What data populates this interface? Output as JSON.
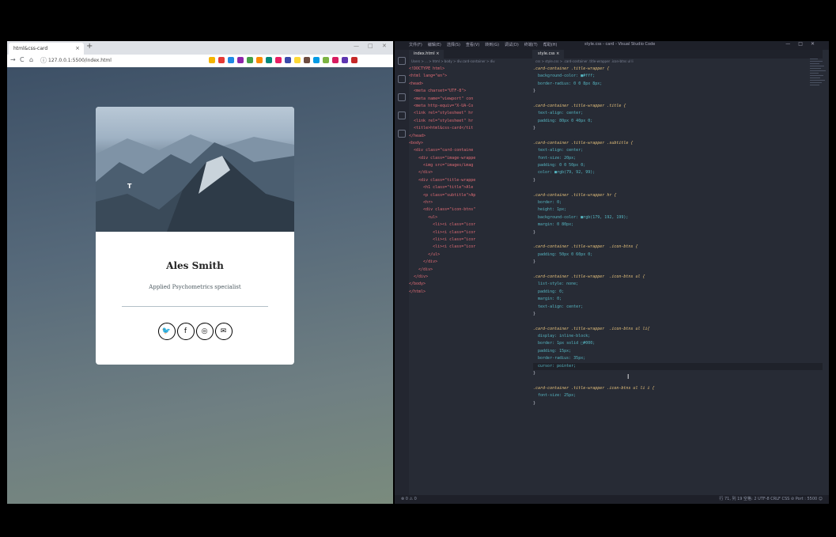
{
  "browser": {
    "tab_title": "html&css-card",
    "tab_close": "×",
    "new_tab": "+",
    "win_min": "—",
    "win_max": "□",
    "win_close": "✕",
    "back": "→",
    "reload": "C",
    "home": "⌂",
    "info": "ⓘ",
    "url": "127.0.0.1:5500/index.html",
    "ext_colors": [
      "#f4b400",
      "#e53935",
      "#1e88e5",
      "#8e24aa",
      "#43a047",
      "#fb8c00",
      "#00897b",
      "#e91e63",
      "#3949ab",
      "#fdd835",
      "#6d4c41",
      "#039be5",
      "#7cb342",
      "#d81b60",
      "#5e35b1",
      "#c62828"
    ]
  },
  "card": {
    "name": "Ales Smith",
    "subtitle": "Applied Psychometrics specialist",
    "icons": [
      {
        "icon": "twitter-icon",
        "glyph": "🐦"
      },
      {
        "icon": "facebook-icon",
        "glyph": "f"
      },
      {
        "icon": "instagram-icon",
        "glyph": "◎"
      },
      {
        "icon": "mail-icon",
        "glyph": "✉"
      }
    ]
  },
  "vscode": {
    "menu": [
      "文件(F)",
      "编辑(E)",
      "选择(S)",
      "查看(V)",
      "转到(G)",
      "调试(D)",
      "终端(T)",
      "帮助(H)"
    ],
    "window_title": "style.css - card - Visual Studio Code",
    "left_tab": "index.html",
    "left_tab_close": "×",
    "left_crumbs": "Users > ... > html > body > div.card-container > div",
    "right_tab": "style.css",
    "right_tab_close": "×",
    "right_crumbs": "css > style.css > .card-container .title-wrapper .icon-btns ul li",
    "status_left": "⊗ 0 ⚠ 0",
    "status_right": "行 71, 列 19   空格: 2   UTF-8   CRLF   CSS   ⊘ Port : 5500   ☺"
  },
  "html_code": [
    "<!DOCTYPE html>",
    "<html lang=\"en\">",
    "<head>",
    "  <meta charset=\"UTF-8\">",
    "  <meta name=\"viewport\" con",
    "  <meta http-equiv=\"X-UA-Co",
    "  <link rel=\"stylesheet\" hr",
    "  <link rel=\"stylesheet\" hr",
    "  <title>html&css-card</tit",
    "</head>",
    "<body>",
    "  <div class=\"card-containe",
    "    <div class=\"image-wrappe",
    "      <img src=\"images/imag",
    "    </div>",
    "    <div class=\"title-wrappe",
    "      <h1 class=\"title\">Ale",
    "      <p class=\"subtitle\">Ap",
    "      <hr>",
    "      <div class=\"icon-btns\"",
    "        <ul>",
    "          <li><i class=\"icor",
    "          <li><i class=\"icor",
    "          <li><i class=\"icor",
    "          <li><i class=\"icor",
    "        </ul>",
    "      </div>",
    "    </div>",
    "  </div>",
    "</body>",
    "</html>"
  ],
  "css_code": [
    {
      "n": "",
      "t": ".card-container .title-wrapper {",
      "k": "sel"
    },
    {
      "n": "",
      "t": "  background-color: ■#fff;",
      "k": "prop"
    },
    {
      "n": "",
      "t": "  border-radius: 0 0 8px 8px;",
      "k": "prop"
    },
    {
      "n": "",
      "t": "}",
      "k": "pun"
    },
    {
      "n": "",
      "t": "",
      "k": "pun"
    },
    {
      "n": "",
      "t": ".card-container .title-wrapper .title {",
      "k": "sel"
    },
    {
      "n": "",
      "t": "  text-align: center;",
      "k": "prop"
    },
    {
      "n": "",
      "t": "  padding: 80px 0 40px 0;",
      "k": "prop"
    },
    {
      "n": "",
      "t": "}",
      "k": "pun"
    },
    {
      "n": "",
      "t": "",
      "k": "pun"
    },
    {
      "n": "",
      "t": ".card-container .title-wrapper .subtitle {",
      "k": "sel"
    },
    {
      "n": "",
      "t": "  text-align: center;",
      "k": "prop"
    },
    {
      "n": "",
      "t": "  font-size: 20px;",
      "k": "prop"
    },
    {
      "n": "",
      "t": "  padding: 0 0 50px 0;",
      "k": "prop"
    },
    {
      "n": "",
      "t": "  color: ■rgb(79, 92, 99);",
      "k": "prop"
    },
    {
      "n": "",
      "t": "}",
      "k": "pun"
    },
    {
      "n": "",
      "t": "",
      "k": "pun"
    },
    {
      "n": "",
      "t": ".card-container .title-wrapper hr {",
      "k": "sel"
    },
    {
      "n": "",
      "t": "  border: 0;",
      "k": "prop"
    },
    {
      "n": "",
      "t": "  height: 1px;",
      "k": "prop"
    },
    {
      "n": "",
      "t": "  background-color: ■rgb(179, 192, 199);",
      "k": "prop"
    },
    {
      "n": "",
      "t": "  margin: 0 80px;",
      "k": "prop"
    },
    {
      "n": "",
      "t": "}",
      "k": "pun"
    },
    {
      "n": "",
      "t": "",
      "k": "pun"
    },
    {
      "n": "",
      "t": ".card-container .title-wrapper  .icon-btns {",
      "k": "sel"
    },
    {
      "n": "",
      "t": "  padding: 50px 0 60px 0;",
      "k": "prop"
    },
    {
      "n": "",
      "t": "}",
      "k": "pun"
    },
    {
      "n": "",
      "t": "",
      "k": "pun"
    },
    {
      "n": "",
      "t": ".card-container .title-wrapper  .icon-btns ul {",
      "k": "sel"
    },
    {
      "n": "",
      "t": "  list-style: none;",
      "k": "prop"
    },
    {
      "n": "",
      "t": "  padding: 0;",
      "k": "prop"
    },
    {
      "n": "",
      "t": "  margin: 0;",
      "k": "prop"
    },
    {
      "n": "",
      "t": "  text-align: center;",
      "k": "prop"
    },
    {
      "n": "",
      "t": "}",
      "k": "pun"
    },
    {
      "n": "",
      "t": "",
      "k": "pun"
    },
    {
      "n": "",
      "t": ".card-container .title-wrapper  .icon-btns ul li{",
      "k": "sel"
    },
    {
      "n": "",
      "t": "  display: inline-block;",
      "k": "prop"
    },
    {
      "n": "",
      "t": "  border: 1px solid □#000;",
      "k": "prop"
    },
    {
      "n": "",
      "t": "  padding: 15px;",
      "k": "prop"
    },
    {
      "n": "",
      "t": "  border-radius: 35px;",
      "k": "prop"
    },
    {
      "n": "",
      "t": "  cursor: pointer;",
      "k": "cur"
    },
    {
      "n": "",
      "t": "}",
      "k": "pun"
    },
    {
      "n": "",
      "t": "",
      "k": "pun"
    },
    {
      "n": "",
      "t": ".card-container .title-wrapper .icon-btns ul li i {",
      "k": "sel"
    },
    {
      "n": "",
      "t": "  font-size: 25px;",
      "k": "prop"
    },
    {
      "n": "",
      "t": "}",
      "k": "pun"
    }
  ]
}
